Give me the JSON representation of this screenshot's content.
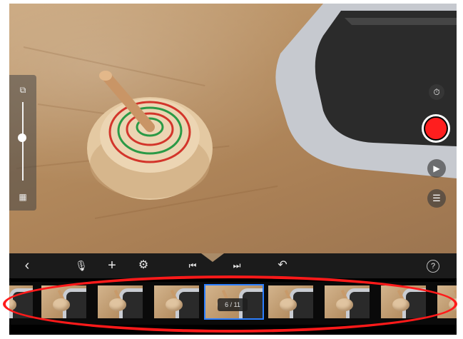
{
  "camera": {
    "scene": "wooden spinning top on a desk",
    "zoom_level": 0.45
  },
  "side_panel": {
    "top_icon": "zoom-wide-icon",
    "bottom_icon": "grid-off-icon"
  },
  "camera_controls": {
    "timer_icon": "timer-icon",
    "record_icon": "record-icon",
    "play_icon": "play-icon",
    "settings_icon": "sliders-icon"
  },
  "toolbar": {
    "back_glyph": "‹",
    "mic_glyph": "🎙",
    "add_glyph": "+",
    "effects_glyph": "⚙",
    "prev_glyph": "⏮",
    "next_glyph": "⏭",
    "undo_glyph": "↶",
    "help_glyph": "?"
  },
  "timeline": {
    "clip_counter": "6 / 11",
    "current_index": 4
  },
  "colors": {
    "accent": "#2c7fff",
    "record": "#ff1e1e",
    "annotation": "#ff1a1a"
  }
}
